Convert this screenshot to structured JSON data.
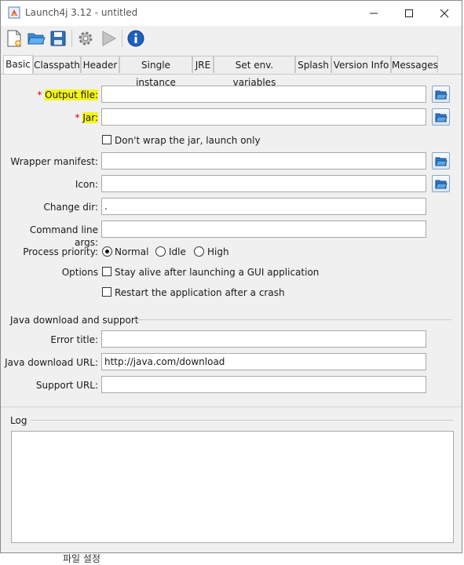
{
  "window": {
    "title": "Launch4j 3.12 - untitled",
    "controls": [
      "minimize",
      "maximize",
      "close"
    ]
  },
  "toolbar": {
    "icons": [
      "new-file-icon",
      "open-folder-icon",
      "save-icon",
      "build-gear-icon",
      "run-play-icon",
      "about-info-icon"
    ]
  },
  "tabs": [
    {
      "label": "Basic",
      "active": true
    },
    {
      "label": "Classpath"
    },
    {
      "label": "Header"
    },
    {
      "label": "Single instance"
    },
    {
      "label": "JRE"
    },
    {
      "label": "Set env. variables"
    },
    {
      "label": "Splash"
    },
    {
      "label": "Version Info"
    },
    {
      "label": "Messages"
    }
  ],
  "form": {
    "required_mark": "*",
    "output_file": {
      "label": "Output file:",
      "value": ""
    },
    "jar": {
      "label": "Jar:",
      "value": ""
    },
    "dont_wrap": {
      "label": "Don't wrap the jar, launch only",
      "checked": false
    },
    "wrapper_manifest": {
      "label": "Wrapper manifest:",
      "value": ""
    },
    "icon": {
      "label": "Icon:",
      "value": ""
    },
    "change_dir": {
      "label": "Change dir:",
      "value": "."
    },
    "cmd_args": {
      "label": "Command line args:",
      "value": ""
    },
    "process_priority": {
      "label": "Process priority:",
      "options": [
        "Normal",
        "Idle",
        "High"
      ],
      "selected": "Normal"
    },
    "options": {
      "label": "Options",
      "stay_alive": {
        "label": "Stay alive after launching a GUI application",
        "checked": false
      },
      "restart": {
        "label": "Restart the application after a crash",
        "checked": false
      }
    }
  },
  "java_download": {
    "section_title": "Java download and support",
    "error_title": {
      "label": "Error title:",
      "value": ""
    },
    "download_url": {
      "label": "Java download URL:",
      "value": "http://java.com/download"
    },
    "support_url": {
      "label": "Support URL:",
      "value": ""
    }
  },
  "log": {
    "title": "Log",
    "content": ""
  },
  "background_text": {
    "left": "파일 설정"
  },
  "colors": {
    "highlight": "#f5f518",
    "required": "#e00000",
    "window_bg": "#f0f0f0"
  }
}
